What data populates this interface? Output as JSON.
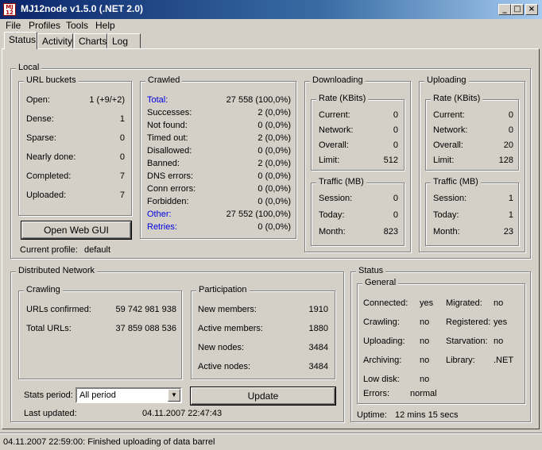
{
  "window": {
    "title": "MJ12node v1.5.0 (.NET 2.0)",
    "app_icon": "MJ\n12",
    "minimize_glyph": "_",
    "maximize_glyph": "□",
    "close_glyph": "×"
  },
  "menu": [
    "File",
    "Profiles",
    "Tools",
    "Help"
  ],
  "tabs": [
    "Status",
    "Activity",
    "Charts",
    "Log"
  ],
  "local": {
    "title": "Local",
    "url_buckets": {
      "title": "URL buckets",
      "rows": [
        {
          "label": "Open:",
          "value": "1 (+9/+2)"
        },
        {
          "label": "Dense:",
          "value": "1"
        },
        {
          "label": "Sparse:",
          "value": "0"
        },
        {
          "label": "Nearly done:",
          "value": "0"
        },
        {
          "label": "Completed:",
          "value": "7"
        },
        {
          "label": "Uploaded:",
          "value": "7"
        }
      ]
    },
    "crawled": {
      "title": "Crawled",
      "rows": [
        {
          "label": "Total:",
          "value": "27 558 (100,0%)"
        },
        {
          "label": "Successes:",
          "value": "2 (0,0%)"
        },
        {
          "label": "Not found:",
          "value": "0 (0,0%)"
        },
        {
          "label": "Timed out:",
          "value": "2 (0,0%)"
        },
        {
          "label": "Disallowed:",
          "value": "0 (0,0%)"
        },
        {
          "label": "Banned:",
          "value": "2 (0,0%)"
        },
        {
          "label": "DNS errors:",
          "value": "0 (0,0%)"
        },
        {
          "label": "Conn errors:",
          "value": "0 (0,0%)"
        },
        {
          "label": "Forbidden:",
          "value": "0 (0,0%)"
        },
        {
          "label": "Other:",
          "value": "27 552 (100,0%)"
        },
        {
          "label": "Retries:",
          "value": "0 (0,0%)"
        }
      ]
    },
    "downloading": {
      "title": "Downloading",
      "rate_title": "Rate (KBits)",
      "rate": [
        {
          "label": "Current:",
          "value": "0"
        },
        {
          "label": "Network:",
          "value": "0"
        },
        {
          "label": "Overall:",
          "value": "0"
        },
        {
          "label": "Limit:",
          "value": "512"
        }
      ],
      "traffic_title": "Traffic (MB)",
      "traffic": [
        {
          "label": "Session:",
          "value": "0"
        },
        {
          "label": "Today:",
          "value": "0"
        },
        {
          "label": "Month:",
          "value": "823"
        }
      ]
    },
    "uploading": {
      "title": "Uploading",
      "rate_title": "Rate (KBits)",
      "rate": [
        {
          "label": "Current:",
          "value": "0"
        },
        {
          "label": "Network:",
          "value": "0"
        },
        {
          "label": "Overall:",
          "value": "20"
        },
        {
          "label": "Limit:",
          "value": "128"
        }
      ],
      "traffic_title": "Traffic (MB)",
      "traffic": [
        {
          "label": "Session:",
          "value": "1"
        },
        {
          "label": "Today:",
          "value": "1"
        },
        {
          "label": "Month:",
          "value": "23"
        }
      ]
    },
    "open_web_gui": "Open Web GUI",
    "current_profile_label": "Current profile:",
    "current_profile_value": "default"
  },
  "distributed": {
    "title": "Distributed Network",
    "crawling_title": "Crawling",
    "crawling": [
      {
        "label": "URLs confirmed:",
        "value": "59 742 981 938"
      },
      {
        "label": "Total URLs:",
        "value": "37 859 088 536"
      }
    ],
    "participation_title": "Participation",
    "participation": [
      {
        "label": "New members:",
        "value": "1910"
      },
      {
        "label": "Active members:",
        "value": "1880"
      },
      {
        "label": "New nodes:",
        "value": "3484"
      },
      {
        "label": "Active nodes:",
        "value": "3484"
      }
    ],
    "stats_period_label": "Stats period:",
    "stats_period_value": "All period",
    "update_button": "Update",
    "last_updated_label": "Last updated:",
    "last_updated_value": "04.11.2007 22:47:43"
  },
  "status": {
    "title": "Status",
    "general_title": "General",
    "left": [
      {
        "label": "Connected:",
        "value": "yes"
      },
      {
        "label": "Crawling:",
        "value": "no"
      },
      {
        "label": "Uploading:",
        "value": "no"
      },
      {
        "label": "Archiving:",
        "value": "no"
      },
      {
        "label": "Low disk:",
        "value": "no"
      }
    ],
    "right": [
      {
        "label": "Migrated:",
        "value": "no"
      },
      {
        "label": "Registered:",
        "value": "yes"
      },
      {
        "label": "Starvation:",
        "value": "no"
      },
      {
        "label": "Library:",
        "value": ".NET"
      }
    ],
    "errors_label": "Errors:",
    "errors_value": "normal",
    "uptime_label": "Uptime:",
    "uptime_value": "12 mins 15 secs"
  },
  "statusbar": "04.11.2007 22:59:00: Finished uploading of data barrel"
}
